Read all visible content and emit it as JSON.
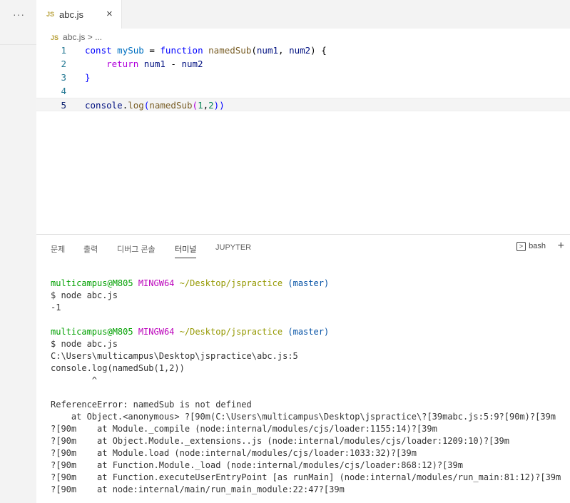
{
  "sidebar": {
    "more_label": "···"
  },
  "tabs": [
    {
      "badge": "JS",
      "label": "abc.js",
      "close": "×"
    }
  ],
  "breadcrumb": {
    "badge": "JS",
    "file": "abc.js",
    "sep": ">",
    "rest": "..."
  },
  "editor": {
    "line_numbers": [
      "1",
      "2",
      "3",
      "4",
      "5"
    ],
    "line1": {
      "kw": "const",
      "var": "mySub",
      "eq": " = ",
      "kw2": "function",
      "fn": "namedSub",
      "p1": "num1",
      "p2": "num2",
      "tail": ") {"
    },
    "line2": {
      "kw": "return",
      "a": "num1",
      "op": " - ",
      "b": "num2"
    },
    "line3": {
      "text": "}"
    },
    "line5": {
      "obj": "console",
      "dot": ".",
      "fn": "log",
      "open": "(",
      "fn2": "namedSub",
      "open2": "(",
      "n1": "1",
      "comma": ",",
      "n2": "2",
      "close": "))"
    }
  },
  "panel": {
    "tabs": [
      "문제",
      "출력",
      "디버그 콘솔",
      "터미널",
      "JUPYTER"
    ],
    "active_tab": "터미널",
    "shell_label": "bash",
    "add_label": "+",
    "terminal_icon": ">"
  },
  "terminal": {
    "prompt1": {
      "user": "multicampus@M805",
      "host": "MINGW64",
      "path": "~/Desktop/jspractice",
      "branch": "(master)"
    },
    "cmd1": "$ node abc.js",
    "out1": "-1",
    "prompt2": {
      "user": "multicampus@M805",
      "host": "MINGW64",
      "path": "~/Desktop/jspractice",
      "branch": "(master)"
    },
    "cmd2": "$ node abc.js",
    "error_lines": [
      "C:\\Users\\multicampus\\Desktop\\jspractice\\abc.js:5",
      "console.log(namedSub(1,2))",
      "        ^",
      "",
      "ReferenceError: namedSub is not defined",
      "    at Object.<anonymous> ?[90m(C:\\Users\\multicampus\\Desktop\\jspractice\\?[39mabc.js:5:9?[90m)?[39m",
      "?[90m    at Module._compile (node:internal/modules/cjs/loader:1155:14)?[39m",
      "?[90m    at Object.Module._extensions..js (node:internal/modules/cjs/loader:1209:10)?[39m",
      "?[90m    at Module.load (node:internal/modules/cjs/loader:1033:32)?[39m",
      "?[90m    at Function.Module._load (node:internal/modules/cjs/loader:868:12)?[39m",
      "?[90m    at Function.executeUserEntryPoint [as runMain] (node:internal/modules/run_main:81:12)?[39m",
      "?[90m    at node:internal/main/run_main_module:22:47?[39m"
    ]
  },
  "colors": {
    "accent": "#0000ff",
    "keyword2": "#af00db",
    "function": "#795e26",
    "number": "#098658",
    "terminal_user": "#00a000",
    "terminal_host": "#bc05bc",
    "terminal_path": "#949800",
    "terminal_branch": "#0451a5"
  }
}
